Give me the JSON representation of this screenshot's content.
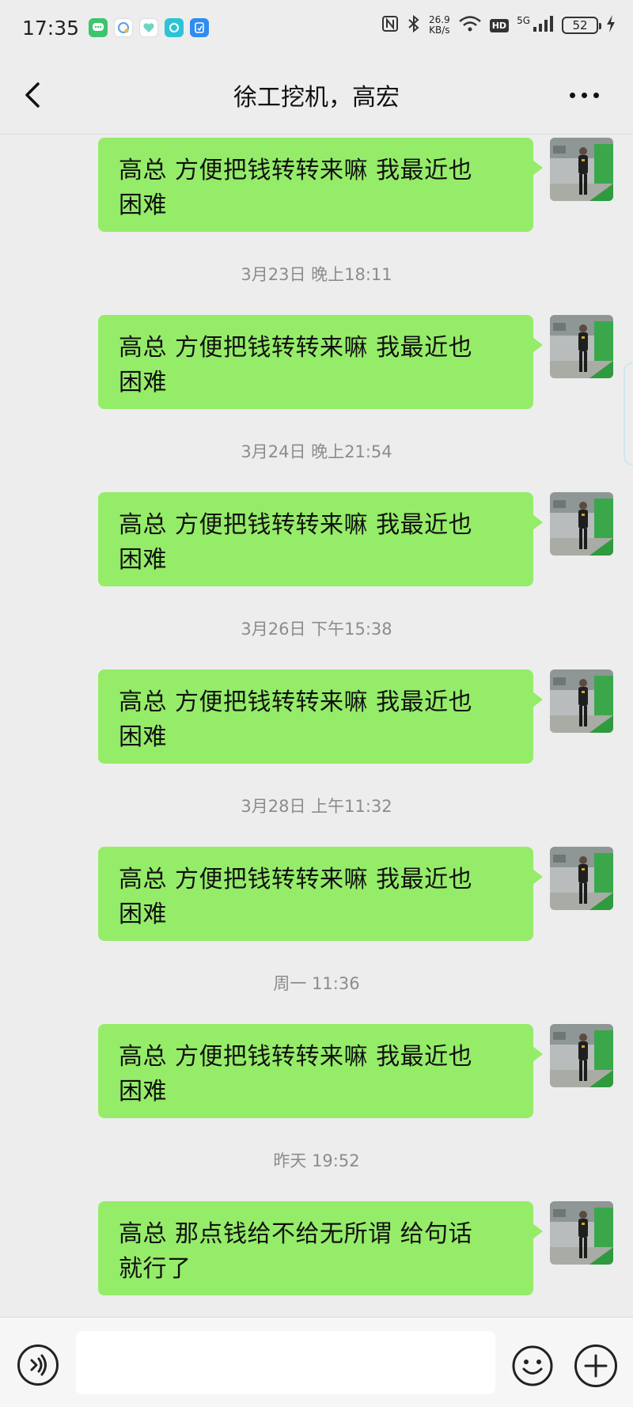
{
  "status_bar": {
    "time": "17:35",
    "net_speed_value": "26.9",
    "net_speed_unit": "KB/s",
    "hd": "HD",
    "network": "5G",
    "battery": "52",
    "notification_icons": [
      "messages-icon",
      "qq-icon",
      "heart-app-icon",
      "browser-icon",
      "clipboard-icon"
    ]
  },
  "header": {
    "title": "徐工挖机，高宏"
  },
  "messages": [
    {
      "text_line1": "高总  方便把钱转转来嘛   我最近也",
      "text_line2": "困难"
    },
    {
      "timestamp": "3月23日 晚上18:11",
      "text_line1": "高总  方便把钱转转来嘛   我最近也",
      "text_line2": "困难"
    },
    {
      "timestamp": "3月24日 晚上21:54",
      "text_line1": "高总  方便把钱转转来嘛   我最近也",
      "text_line2": "困难"
    },
    {
      "timestamp": "3月26日 下午15:38",
      "text_line1": "高总  方便把钱转转来嘛   我最近也",
      "text_line2": "困难"
    },
    {
      "timestamp": "3月28日 上午11:32",
      "text_line1": "高总  方便把钱转转来嘛   我最近也",
      "text_line2": "困难"
    },
    {
      "timestamp": "周一 11:36",
      "text_line1": "高总  方便把钱转转来嘛   我最近也",
      "text_line2": "困难"
    },
    {
      "timestamp": "昨天 19:52",
      "text_line1": "高总 那点钱给不给无所谓   给句话",
      "text_line2": "就行了"
    }
  ],
  "colors": {
    "bubble_green": "#95ec69",
    "background": "#ededed",
    "timestamp_gray": "#8c8c8c"
  }
}
